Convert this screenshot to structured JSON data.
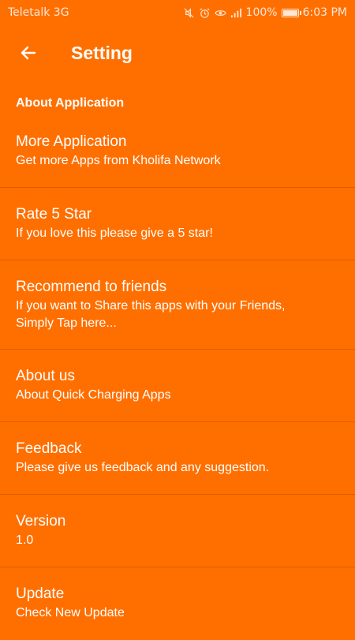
{
  "status_bar": {
    "carrier": "Teletalk 3G",
    "battery_text": "100%",
    "battery_level_percent": 100,
    "time": "6:03 PM",
    "icons": [
      "mute-icon",
      "alarm-icon",
      "eye-icon",
      "signal-icon",
      "battery-icon"
    ]
  },
  "app_bar": {
    "title": "Setting",
    "back_icon": "arrow-left-icon"
  },
  "section": {
    "header": "About Application"
  },
  "items": [
    {
      "title": "More Application",
      "subtitle": "Get more Apps from Kholifa Network"
    },
    {
      "title": "Rate 5 Star",
      "subtitle": "If you love this please give a 5 star!"
    },
    {
      "title": "Recommend to friends",
      "subtitle_line1": "If you want to Share this apps with your Friends,",
      "subtitle_line2": "Simply Tap here..."
    },
    {
      "title": "About us",
      "subtitle": "About Quick Charging Apps"
    },
    {
      "title": "Feedback",
      "subtitle": "Please give us feedback and any suggestion."
    },
    {
      "title": "Version",
      "subtitle": "1.0"
    },
    {
      "title": "Update",
      "subtitle": "Check New Update"
    }
  ],
  "colors": {
    "background": "#FF6F00",
    "text": "#FFFFFF"
  }
}
